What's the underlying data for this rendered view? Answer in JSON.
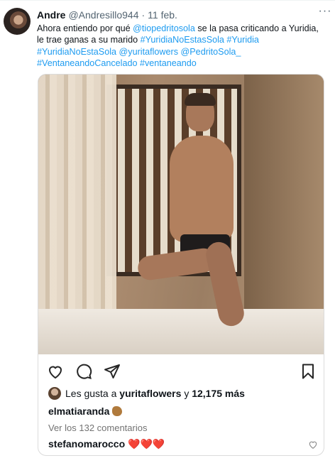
{
  "tweet": {
    "author_name": "Andre",
    "author_handle": "@Andresillo944",
    "separator": "·",
    "date": "11 feb.",
    "more_label": "···",
    "text_parts": {
      "t1": "Ahora entiendo por qué ",
      "l1": "@tiopedritosola",
      "t2": " se la pasa criticando a Yuridia, le trae ganas a su marido ",
      "l2": "#YuridiaNoEstasSola",
      "t3": " ",
      "l3": "#Yuridia",
      "t4": " ",
      "l4": "#YuridiaNoEstaSola",
      "t5": " ",
      "l5": "@yuritaflowers",
      "t6": " ",
      "l6": "@PedritoSola_",
      "t7": " ",
      "l7": "#VentaneandoCancelado",
      "t8": " ",
      "l8": "#ventaneando"
    }
  },
  "instagram": {
    "likes_prefix": "Les gusta a",
    "likes_user": "yuritaflowers",
    "likes_connector": "y",
    "likes_count": "12,175 más",
    "comment1_user": "elmatiaranda",
    "view_comments": "Ver los 132 comentarios",
    "comment2_user": "stefanomarocco",
    "comment2_text": "❤️❤️❤️",
    "icons": [
      "heart-icon",
      "comment-icon",
      "share-icon",
      "bookmark-icon"
    ]
  },
  "colors": {
    "link": "#1d9bf0",
    "muted": "#536471",
    "heart_red": "#e41e3f"
  }
}
